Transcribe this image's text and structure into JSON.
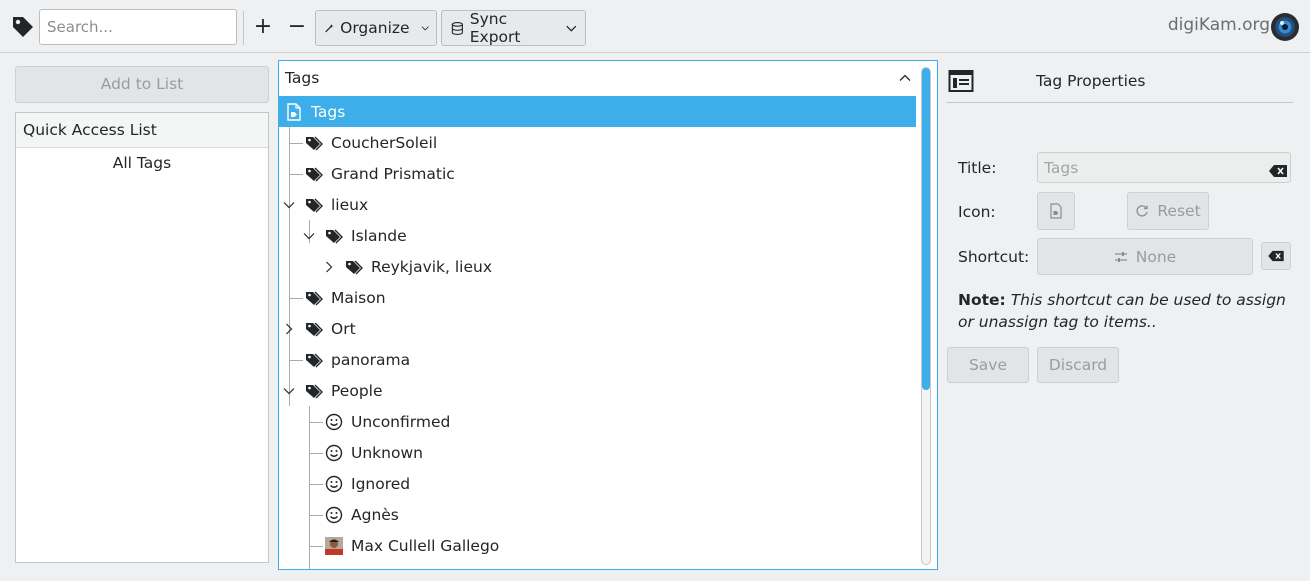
{
  "toolbar": {
    "search_placeholder": "Search...",
    "add_label": "+",
    "remove_label": "−",
    "organize_label": "Organize",
    "sync_export_label": "Sync Export",
    "brand": "digiKam.org"
  },
  "left_panel": {
    "add_to_list_label": "Add to List",
    "quick_access_title": "Quick Access List",
    "items": [
      "All Tags"
    ]
  },
  "tree": {
    "header": "Tags",
    "rows": [
      {
        "label": "Tags",
        "icon": "tag-document-icon",
        "selected": true
      },
      {
        "label": "CoucherSoleil",
        "icon": "tag-icon"
      },
      {
        "label": "Grand Prismatic",
        "icon": "tag-icon"
      },
      {
        "label": "lieux",
        "icon": "tag-icon",
        "expanded": true
      },
      {
        "label": "Islande",
        "icon": "tag-icon",
        "expanded": true
      },
      {
        "label": "Reykjavik, lieux",
        "icon": "tag-icon",
        "collapsed": true
      },
      {
        "label": "Maison",
        "icon": "tag-icon"
      },
      {
        "label": "Ort",
        "icon": "tag-icon",
        "collapsed": true
      },
      {
        "label": "panorama",
        "icon": "tag-icon"
      },
      {
        "label": "People",
        "icon": "tag-icon",
        "expanded": true
      },
      {
        "label": "Unconfirmed",
        "icon": "smiley-icon"
      },
      {
        "label": "Unknown",
        "icon": "smiley-icon"
      },
      {
        "label": "Ignored",
        "icon": "smiley-icon"
      },
      {
        "label": "Agnès",
        "icon": "smiley-icon"
      },
      {
        "label": "Max Cullell Gallego",
        "icon": "person-photo-icon"
      }
    ]
  },
  "properties": {
    "title": "Tag Properties",
    "title_label": "Title:",
    "title_value": "Tags",
    "icon_label": "Icon:",
    "reset_label": "Reset",
    "shortcut_label": "Shortcut:",
    "shortcut_value": "None",
    "note_bold": "Note:",
    "note_text": "This shortcut can be used to assign or unassign tag to items..",
    "save_label": "Save",
    "discard_label": "Discard"
  },
  "colors": {
    "accent": "#3daee9",
    "background": "#eff0f1",
    "text": "#232629"
  }
}
